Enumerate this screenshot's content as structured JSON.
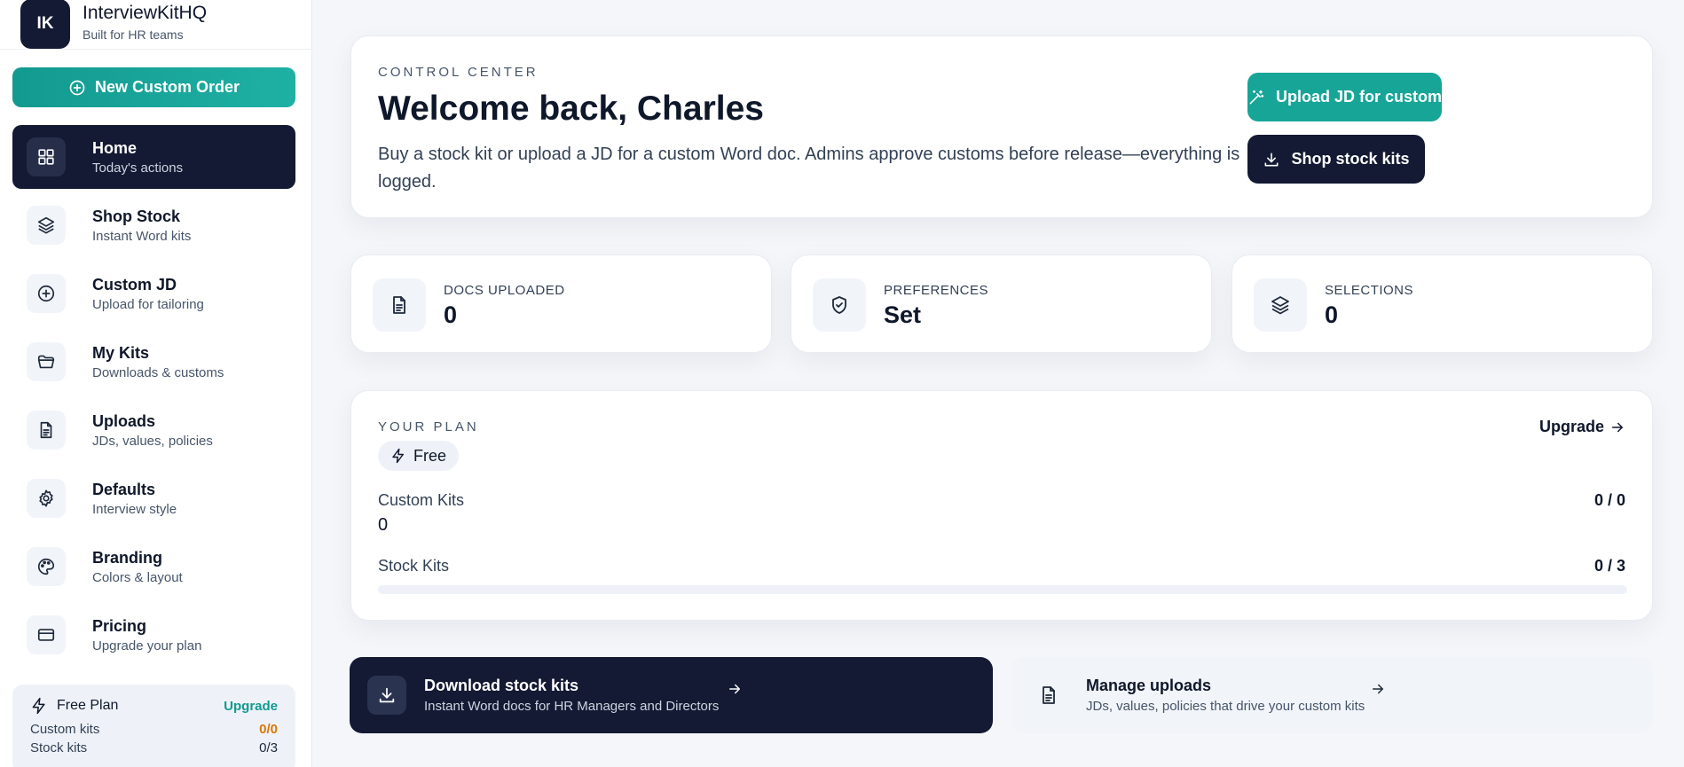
{
  "brand": {
    "initials": "IK",
    "name": "InterviewKitHQ",
    "tagline": "Built for HR teams"
  },
  "sidebar": {
    "new_order_label": "New Custom Order",
    "items": [
      {
        "label": "Home",
        "sub": "Today's actions",
        "icon": "grid-icon",
        "active": true
      },
      {
        "label": "Shop Stock",
        "sub": "Instant Word kits",
        "icon": "layers-icon"
      },
      {
        "label": "Custom JD",
        "sub": "Upload for tailoring",
        "icon": "plus-circle-icon"
      },
      {
        "label": "My Kits",
        "sub": "Downloads & customs",
        "icon": "folder-icon"
      },
      {
        "label": "Uploads",
        "sub": "JDs, values, policies",
        "icon": "file-icon"
      },
      {
        "label": "Defaults",
        "sub": "Interview style",
        "icon": "gear-icon"
      },
      {
        "label": "Branding",
        "sub": "Colors & layout",
        "icon": "palette-icon"
      },
      {
        "label": "Pricing",
        "sub": "Upgrade your plan",
        "icon": "card-icon"
      }
    ],
    "plan": {
      "title": "Free Plan",
      "upgrade": "Upgrade",
      "custom_label": "Custom kits",
      "custom_value": "0/0",
      "stock_label": "Stock kits",
      "stock_value": "0/3"
    }
  },
  "hero": {
    "eyebrow": "CONTROL CENTER",
    "title": "Welcome back, Charles",
    "description": "Buy a stock kit or upload a JD for a custom Word doc. Admins approve customs before release—everything is logged.",
    "upload_button": "Upload JD for custom",
    "shop_button": "Shop stock kits"
  },
  "stats": [
    {
      "label": "DOCS UPLOADED",
      "value": "0",
      "icon": "document-icon"
    },
    {
      "label": "PREFERENCES",
      "value": "Set",
      "icon": "shield-check-icon"
    },
    {
      "label": "SELECTIONS",
      "value": "0",
      "icon": "layers-icon"
    }
  ],
  "plan": {
    "eyebrow": "YOUR PLAN",
    "badge": "Free",
    "upgrade": "Upgrade",
    "custom_label": "Custom Kits",
    "custom_ratio": "0 / 0",
    "custom_count": "0",
    "stock_label": "Stock Kits",
    "stock_ratio": "0 / 3",
    "stock_progress": 0
  },
  "actions": [
    {
      "title": "Download stock kits",
      "sub": "Instant Word docs for HR Managers and Directors",
      "icon": "download-icon"
    },
    {
      "title": "Manage uploads",
      "sub": "JDs, values, policies that drive your custom kits",
      "icon": "file-icon"
    }
  ],
  "colors": {
    "accent": "#17a598",
    "navy": "#141a33",
    "warning": "#d97706"
  }
}
